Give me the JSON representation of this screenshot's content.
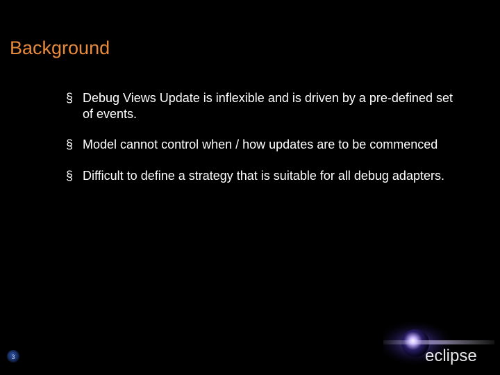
{
  "title": "Background",
  "bullets": [
    "Debug Views Update is inflexible and is driven by a pre-defined set of events.",
    "Model cannot control when / how updates are to be commenced",
    "Difficult to define a strategy that is suitable for all debug adapters."
  ],
  "page_number": "3",
  "logo_text": "eclipse"
}
